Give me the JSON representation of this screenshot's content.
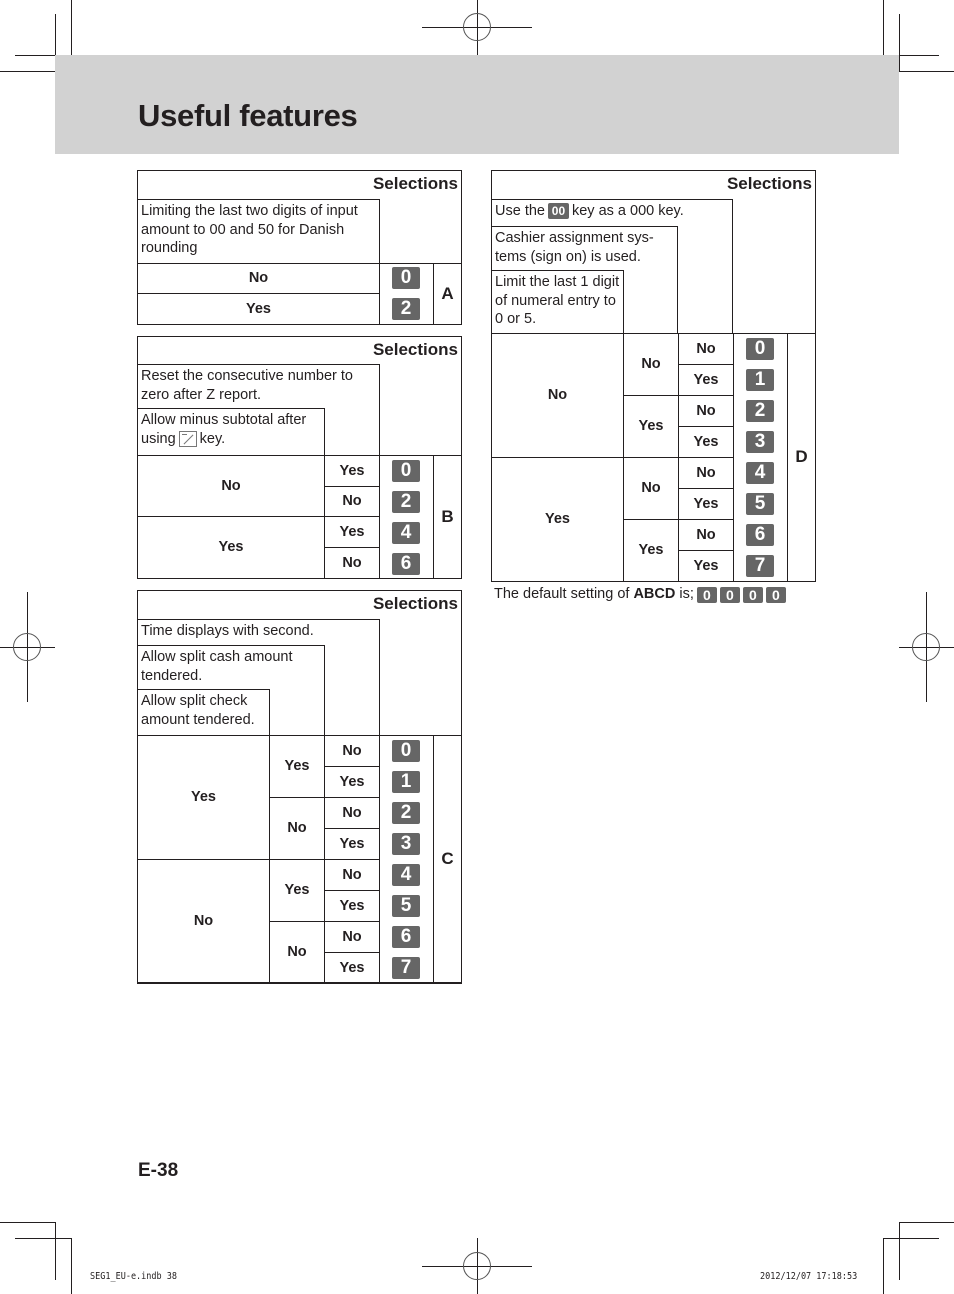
{
  "page": {
    "title": "Useful features",
    "page_number": "E-38",
    "slug_left": "SEG1_EU-e.indb   38",
    "slug_right": "2012/12/07   17:18:53",
    "colors": {
      "header_band": "#d2d2d2",
      "keycap": "#666666",
      "text": "#231f20"
    }
  },
  "table_a": {
    "heading": "Selections",
    "description": "Limiting the last two digits of input amount to 00 and 50 for Danish rounding",
    "rows": [
      {
        "option": "No",
        "value": "0"
      },
      {
        "option": "Yes",
        "value": "2"
      }
    ],
    "letter": "A"
  },
  "table_b": {
    "heading": "Selections",
    "descriptions": [
      "Reset the consecutive number to zero after Z report.",
      {
        "before": "Allow minus subtotal after using",
        "key_icon": "minus-percent-coupon-key-icon",
        "after": "key."
      }
    ],
    "groups": [
      {
        "option": "No",
        "rows": [
          {
            "option": "Yes",
            "value": "0"
          },
          {
            "option": "No",
            "value": "2"
          }
        ]
      },
      {
        "option": "Yes",
        "rows": [
          {
            "option": "Yes",
            "value": "4"
          },
          {
            "option": "No",
            "value": "6"
          }
        ]
      }
    ],
    "letter": "B"
  },
  "table_c": {
    "heading": "Selections",
    "descriptions": [
      "Time displays with second.",
      "Allow split cash amount tendered.",
      "Allow split check amount tendered."
    ],
    "groups": [
      {
        "option": "Yes",
        "subgroups": [
          {
            "option": "Yes",
            "rows": [
              {
                "option": "No",
                "value": "0"
              },
              {
                "option": "Yes",
                "value": "1"
              }
            ]
          },
          {
            "option": "No",
            "rows": [
              {
                "option": "No",
                "value": "2"
              },
              {
                "option": "Yes",
                "value": "3"
              }
            ]
          }
        ]
      },
      {
        "option": "No",
        "subgroups": [
          {
            "option": "Yes",
            "rows": [
              {
                "option": "No",
                "value": "4"
              },
              {
                "option": "Yes",
                "value": "5"
              }
            ]
          },
          {
            "option": "No",
            "rows": [
              {
                "option": "No",
                "value": "6"
              },
              {
                "option": "Yes",
                "value": "7"
              }
            ]
          }
        ]
      }
    ],
    "letter": "C"
  },
  "table_d": {
    "heading": "Selections",
    "descriptions": [
      {
        "before": "Use the",
        "key": "00",
        "after": "key as a 000 key."
      },
      "Cashier assignment sys-tems (sign on) is used.",
      "Limit the last 1 digit of numeral entry to 0 or 5."
    ],
    "groups": [
      {
        "option": "No",
        "subgroups": [
          {
            "option": "No",
            "rows": [
              {
                "option": "No",
                "value": "0"
              },
              {
                "option": "Yes",
                "value": "1"
              }
            ]
          },
          {
            "option": "Yes",
            "rows": [
              {
                "option": "No",
                "value": "2"
              },
              {
                "option": "Yes",
                "value": "3"
              }
            ]
          }
        ]
      },
      {
        "option": "Yes",
        "subgroups": [
          {
            "option": "No",
            "rows": [
              {
                "option": "No",
                "value": "4"
              },
              {
                "option": "Yes",
                "value": "5"
              }
            ]
          },
          {
            "option": "Yes",
            "rows": [
              {
                "option": "No",
                "value": "6"
              },
              {
                "option": "Yes",
                "value": "7"
              }
            ]
          }
        ]
      }
    ],
    "letter": "D"
  },
  "default_setting": {
    "prefix": "The default setting of",
    "bold": "ABCD",
    "suffix": "is;",
    "values": [
      "0",
      "0",
      "0",
      "0"
    ]
  }
}
